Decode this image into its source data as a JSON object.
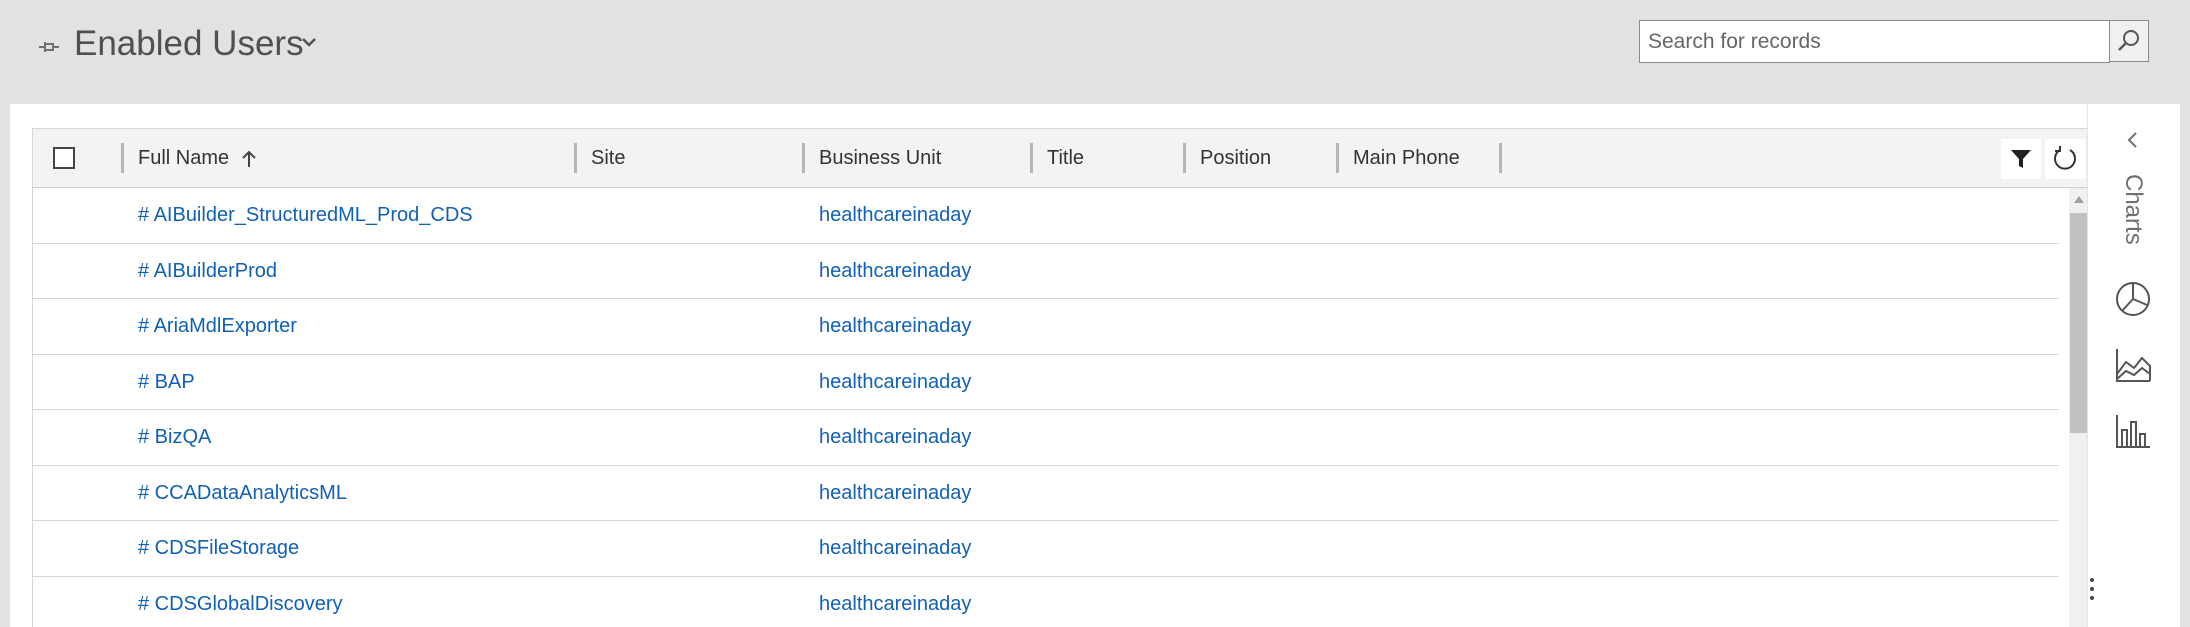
{
  "header": {
    "view_title": "Enabled Users",
    "search_placeholder": "Search for records"
  },
  "grid": {
    "columns": [
      "Full Name",
      "Site",
      "Business Unit",
      "Title",
      "Position",
      "Main Phone"
    ],
    "sort": {
      "column": "Full Name",
      "direction": "ascending"
    },
    "rows": [
      {
        "full_name": "# AIBuilder_StructuredML_Prod_CDS",
        "business_unit": "healthcareinaday"
      },
      {
        "full_name": "# AIBuilderProd",
        "business_unit": "healthcareinaday"
      },
      {
        "full_name": "# AriaMdlExporter",
        "business_unit": "healthcareinaday"
      },
      {
        "full_name": "# BAP",
        "business_unit": "healthcareinaday"
      },
      {
        "full_name": "# BizQA",
        "business_unit": "healthcareinaday"
      },
      {
        "full_name": "# CCADataAnalyticsML",
        "business_unit": "healthcareinaday"
      },
      {
        "full_name": "# CDSFileStorage",
        "business_unit": "healthcareinaday"
      },
      {
        "full_name": "# CDSGlobalDiscovery",
        "business_unit": "healthcareinaday"
      }
    ]
  },
  "charts_panel": {
    "label": "Charts",
    "icons": [
      "pie-chart-icon",
      "area-chart-icon",
      "bar-chart-icon"
    ]
  },
  "colors": {
    "link": "#1160b7",
    "header_bg": "#e2e2e2",
    "grid_header_bg": "#f3f3f3"
  }
}
